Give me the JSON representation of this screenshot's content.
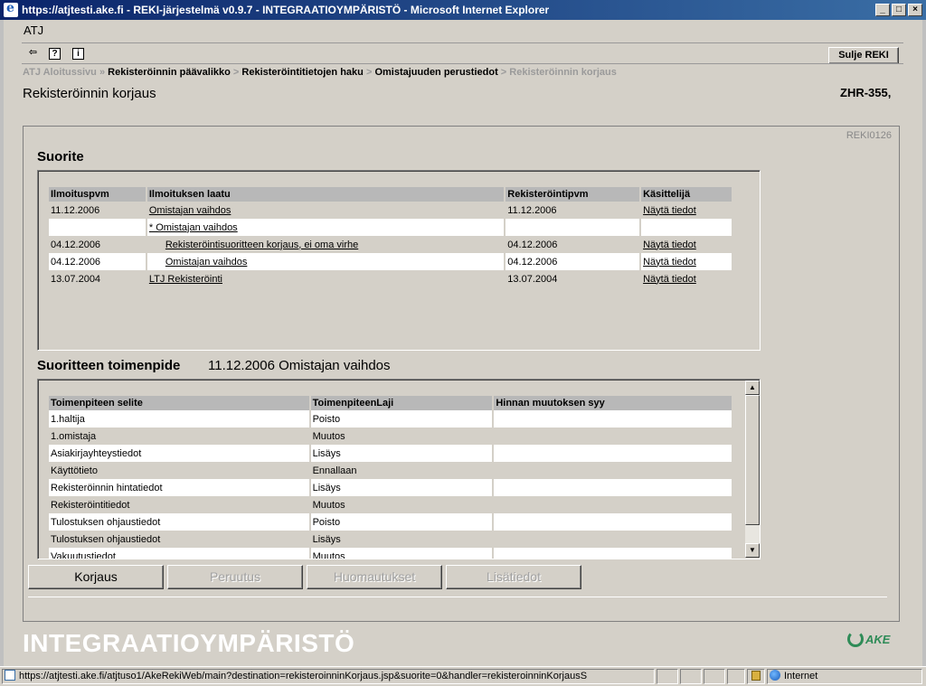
{
  "window": {
    "title": "https://atjtesti.ake.fi - REKI-järjestelmä v0.9.7 - INTEGRAATIOYMPÄRISTÖ - Microsoft Internet Explorer",
    "min": "_",
    "max": "□",
    "close": "×"
  },
  "app": {
    "name": "ATJ",
    "back_icon": "⇦",
    "help_icon": "?",
    "info_icon": "i",
    "close_label": "Sulje REKI"
  },
  "breadcrumb": {
    "items": [
      "ATJ Aloitussivu",
      "Rekisteröinnin päävalikko",
      "Rekisteröintitietojen haku",
      "Omistajuuden perustiedot",
      "Rekisteröinnin korjaus"
    ],
    "sep1": " » ",
    "sep": " > "
  },
  "page": {
    "title": "Rekisteröinnin korjaus",
    "plate": "ZHR-355,",
    "code": "REKI0126"
  },
  "suorite": {
    "title": "Suorite",
    "headers": [
      "Ilmoituspvm",
      "Ilmoituksen laatu",
      "Rekisteröintipvm",
      "Käsittelijä"
    ],
    "rows": [
      {
        "date": "11.12.2006",
        "type": "Omistajan vaihdos",
        "reg": "11.12.2006",
        "handler": "Näytä tiedot"
      },
      {
        "date": "",
        "type": "* Omistajan vaihdos",
        "reg": "",
        "handler": ""
      },
      {
        "date": "04.12.2006",
        "type": "Rekisteröintisuoritteen korjaus, ei oma virhe",
        "reg": "04.12.2006",
        "handler": "Näytä tiedot"
      },
      {
        "date": "04.12.2006",
        "type": "Omistajan vaihdos",
        "reg": "04.12.2006",
        "handler": "Näytä tiedot"
      },
      {
        "date": "13.07.2004",
        "type": "LTJ  Rekisteröinti",
        "reg": "13.07.2004",
        "handler": "Näytä tiedot"
      }
    ]
  },
  "toimenpide": {
    "title": "Suoritteen toimenpide",
    "subtitle": "11.12.2006 Omistajan vaihdos",
    "headers": [
      "Toimenpiteen selite",
      "ToimenpiteenLaji",
      "Hinnan muutoksen syy"
    ],
    "rows": [
      {
        "desc": "1.haltija",
        "kind": "Poisto",
        "reason": ""
      },
      {
        "desc": "1.omistaja",
        "kind": "Muutos",
        "reason": ""
      },
      {
        "desc": "Asiakirjayhteystiedot",
        "kind": "Lisäys",
        "reason": ""
      },
      {
        "desc": "Käyttötieto",
        "kind": "Ennallaan",
        "reason": ""
      },
      {
        "desc": "Rekisteröinnin hintatiedot",
        "kind": "Lisäys",
        "reason": ""
      },
      {
        "desc": "Rekisteröintitiedot",
        "kind": "Muutos",
        "reason": ""
      },
      {
        "desc": "Tulostuksen ohjaustiedot",
        "kind": "Poisto",
        "reason": ""
      },
      {
        "desc": "Tulostuksen ohjaustiedot",
        "kind": "Lisäys",
        "reason": ""
      },
      {
        "desc": "Vakuutustiedot",
        "kind": "Muutos",
        "reason": ""
      }
    ]
  },
  "actions": {
    "korjaus": "Korjaus",
    "peruutus": "Peruutus",
    "huomautukset": "Huomautukset",
    "lisatiedot": "Lisätiedot"
  },
  "footer": {
    "brand": "INTEGRAATIOYMPÄRISTÖ",
    "logo": "AKE"
  },
  "status": {
    "url": "https://atjtesti.ake.fi/atjtuso1/AkeRekiWeb/main?destination=rekisteroinninKorjaus.jsp&suorite=0&handler=rekisteroinninKorjausS",
    "zone": "Internet"
  }
}
